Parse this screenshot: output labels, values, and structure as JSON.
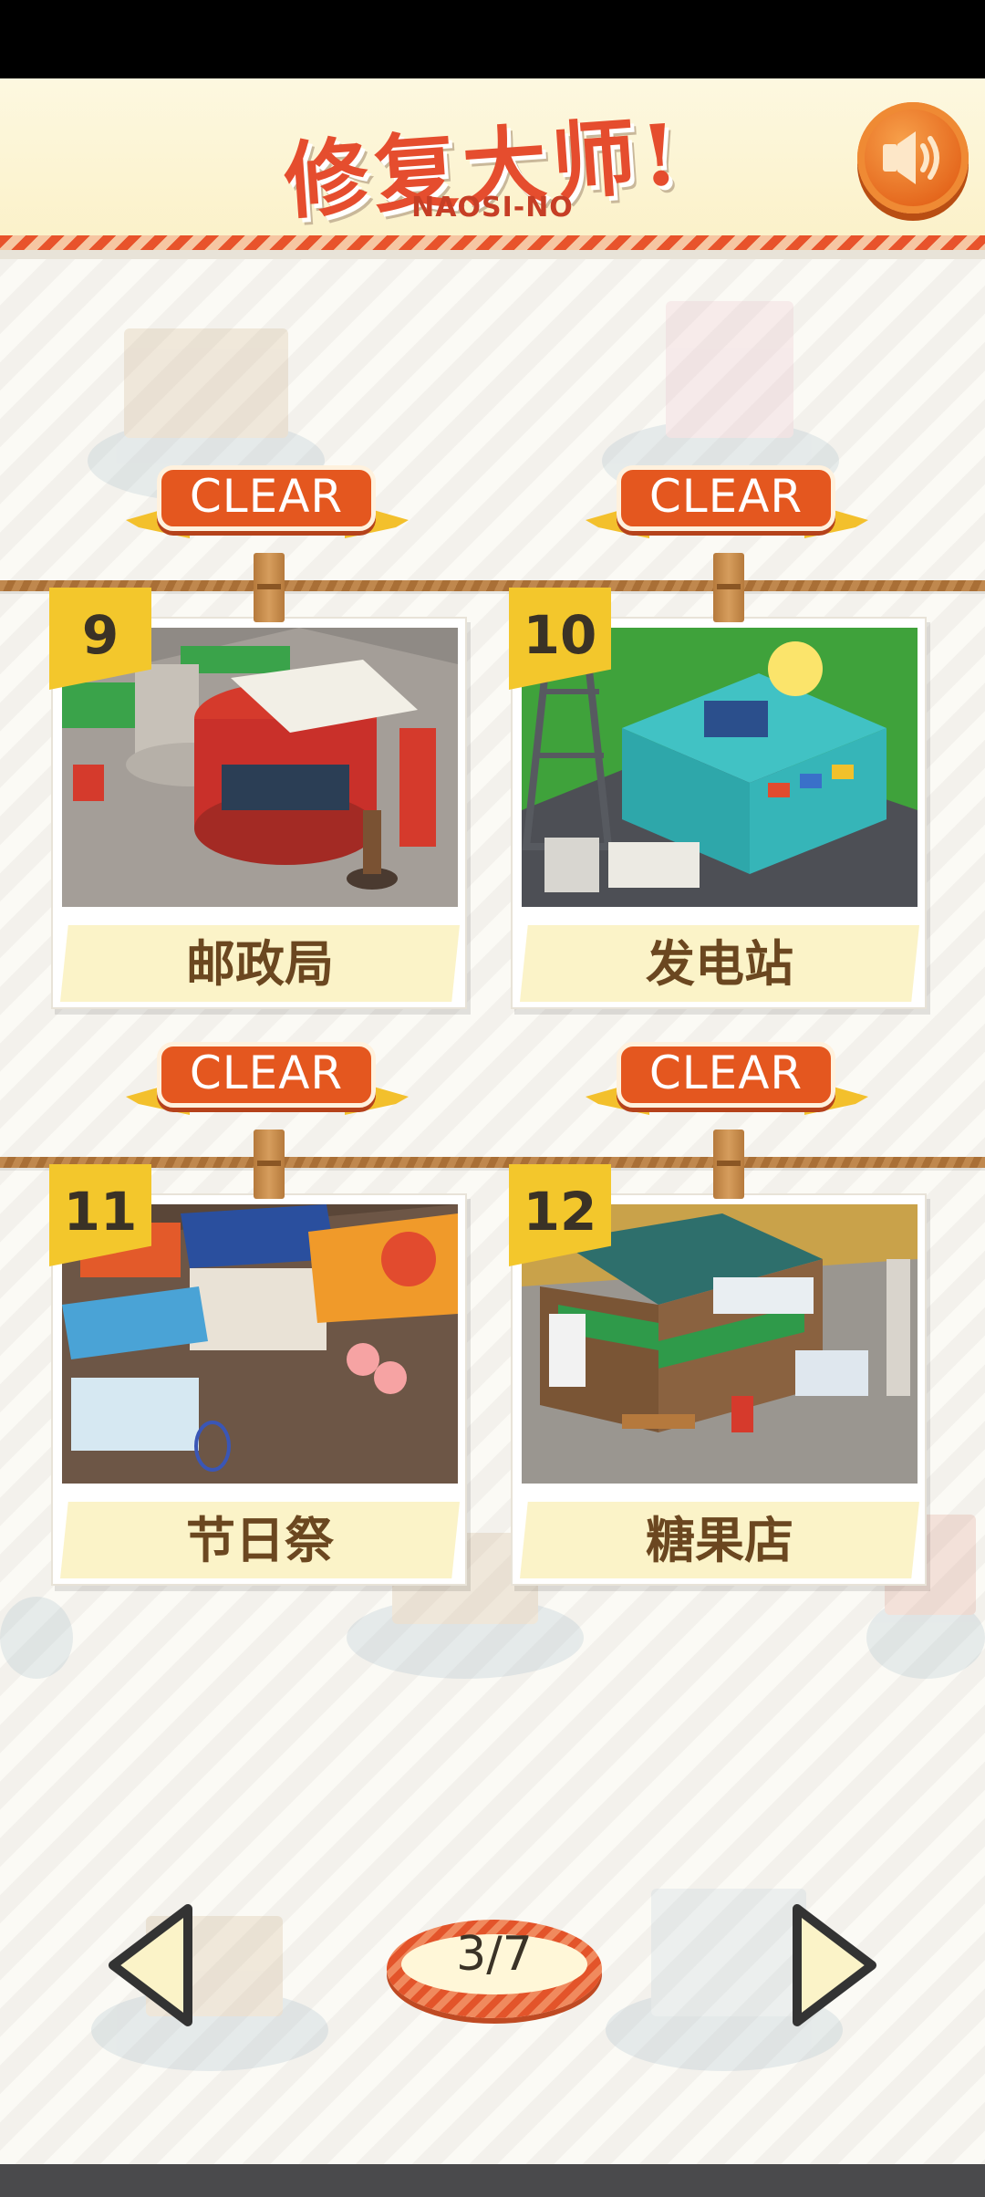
{
  "header": {
    "title": "修复大师!",
    "subtitle": "NAOSI-NO",
    "sound_icon": "speaker-icon"
  },
  "levels": [
    {
      "number": "9",
      "name": "邮政局",
      "status": "CLEAR"
    },
    {
      "number": "10",
      "name": "发电站",
      "status": "CLEAR"
    },
    {
      "number": "11",
      "name": "节日祭",
      "status": "CLEAR"
    },
    {
      "number": "12",
      "name": "糖果店",
      "status": "CLEAR"
    }
  ],
  "pagination": {
    "current": 3,
    "total": 7,
    "label": "3/7",
    "prev_icon": "triangle-left-icon",
    "next_icon": "triangle-right-icon"
  },
  "colors": {
    "accent_orange": "#e4571f",
    "badge_yellow": "#f3c72c",
    "label_brown": "#6b4720"
  }
}
